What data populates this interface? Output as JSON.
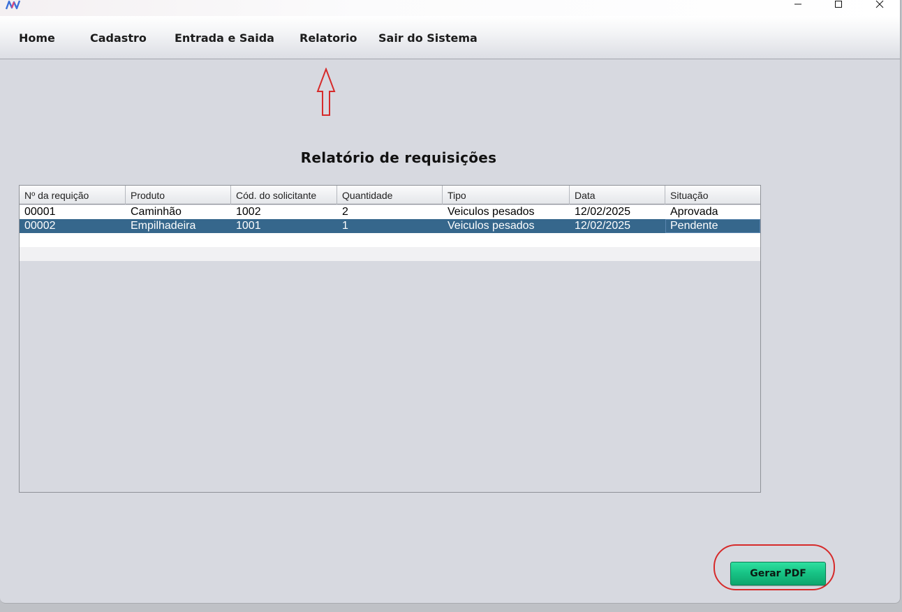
{
  "window": {
    "logo_icon": "app-logo-icon",
    "controls": {
      "minimize_icon": "minimize-icon",
      "maximize_icon": "maximize-icon",
      "close_icon": "close-icon"
    }
  },
  "menu": {
    "items": [
      {
        "label": "Home"
      },
      {
        "label": "Cadastro"
      },
      {
        "label": "Entrada e Saida"
      },
      {
        "label": "Relatorio"
      },
      {
        "label": "Sair do Sistema"
      }
    ]
  },
  "annotation": {
    "arrow_icon": "up-arrow-icon",
    "color": "#d62a2a"
  },
  "report": {
    "title": "Relatório de requisições",
    "columns": [
      "Nº da requição",
      "Produto",
      "Cód. do solicitante",
      "Quantidade",
      "Tipo",
      "Data",
      "Situação"
    ],
    "rows": [
      [
        "00001",
        "Caminhão",
        "1002",
        "2",
        "Veiculos pesados",
        "12/02/2025",
        "Aprovada"
      ],
      [
        "00002",
        "Empilhadeira",
        "1001",
        "1",
        "Veiculos pesados",
        "12/02/2025",
        "Pendente"
      ]
    ],
    "selected_row_index": 1,
    "selection_color": "#36678c"
  },
  "actions": {
    "generate_pdf_label": "Gerar PDF",
    "button_color": "#18c486"
  }
}
